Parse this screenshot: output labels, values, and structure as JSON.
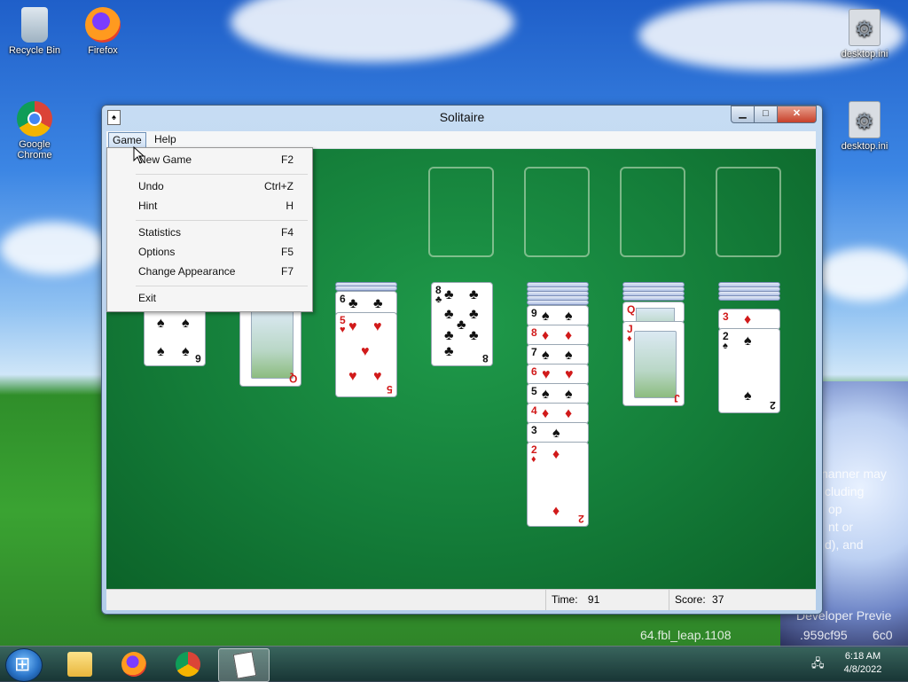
{
  "desktop": {
    "icons": [
      {
        "label": "Recycle Bin",
        "icon": "recycle-bin-icon"
      },
      {
        "label": "Firefox",
        "icon": "firefox-icon"
      },
      {
        "label": "Google Chrome",
        "icon": "chrome-icon"
      },
      {
        "label": "desktop.ini",
        "icon": "settings-file-icon"
      },
      {
        "label": "desktop.ini",
        "icon": "settings-file-icon"
      }
    ],
    "background_text": [
      "nanner may",
      "cluding",
      "op",
      "nt or",
      "d), and",
      "Developer Previe",
      "64.fbl_leap.1108",
      ".959cf95",
      "6c0"
    ]
  },
  "window": {
    "title": "Solitaire",
    "controls": {
      "minimize": "▁",
      "maximize": "□",
      "close": "✕"
    },
    "menu": {
      "game": "Game",
      "help": "Help"
    },
    "status": {
      "time_label": "Time:",
      "time_value": "91",
      "score_label": "Score:",
      "score_value": "37"
    }
  },
  "game_menu": {
    "items": [
      {
        "label": "New Game",
        "shortcut": "F2"
      },
      {
        "label": "Undo",
        "shortcut": "Ctrl+Z"
      },
      {
        "label": "Hint",
        "shortcut": "H"
      },
      {
        "label": "Statistics",
        "shortcut": "F4"
      },
      {
        "label": "Options",
        "shortcut": "F5"
      },
      {
        "label": "Change Appearance",
        "shortcut": "F7"
      },
      {
        "label": "Exit",
        "shortcut": ""
      }
    ]
  },
  "tableau": {
    "col1_top": {
      "rank": "6",
      "suit": "♠"
    },
    "col2_top": {
      "rank": "Q",
      "suit": "♦"
    },
    "col3": [
      {
        "rank": "6",
        "suit": "♣"
      },
      {
        "rank": "5",
        "suit": "♥"
      }
    ],
    "col4": [
      {
        "rank": "8",
        "suit": "♣"
      }
    ],
    "col5": [
      {
        "rank": "9",
        "suit": "♠"
      },
      {
        "rank": "8",
        "suit": "♦"
      },
      {
        "rank": "7",
        "suit": "♠"
      },
      {
        "rank": "6",
        "suit": "♥"
      },
      {
        "rank": "5",
        "suit": "♠"
      },
      {
        "rank": "4",
        "suit": "♦"
      },
      {
        "rank": "3",
        "suit": "♠"
      },
      {
        "rank": "2",
        "suit": "♦"
      }
    ],
    "col6": [
      {
        "rank": "Q",
        "suit": "♦"
      },
      {
        "rank": "J",
        "suit": "♦"
      }
    ],
    "col7": [
      {
        "rank": "3",
        "suit": "♦"
      },
      {
        "rank": "2",
        "suit": "♠"
      }
    ]
  },
  "taskbar": {
    "apps": [
      "start-button",
      "explorer",
      "firefox",
      "chrome",
      "solitaire"
    ],
    "clock_time": "6:18 AM",
    "clock_date": "4/8/2022"
  },
  "colors": {
    "felt": "#147d39",
    "red_suit": "#d11a1a",
    "black_suit": "#111111"
  }
}
